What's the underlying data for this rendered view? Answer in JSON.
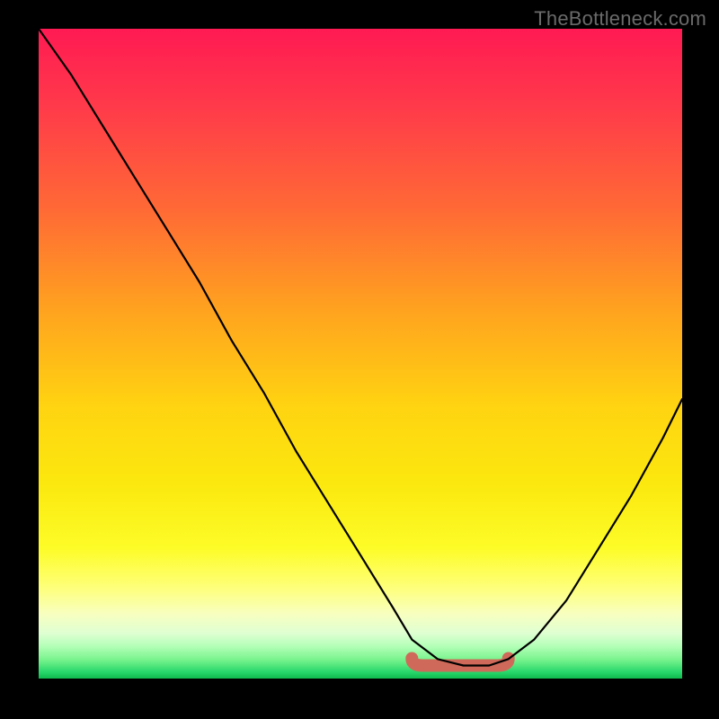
{
  "attribution": "TheBottleneck.com",
  "colors": {
    "page_bg": "#000000",
    "attribution_text": "#6a6a6a",
    "curve": "#000000",
    "valley_stroke": "#cf6a5a",
    "gradient_stops": [
      "#ff1a53",
      "#ff3a4a",
      "#ff6a35",
      "#ffa51e",
      "#ffd311",
      "#fbe80e",
      "#fdfc28",
      "#feff7a",
      "#f8ffbf",
      "#dfffd2",
      "#b4ffb8",
      "#7cf48f",
      "#27d86b",
      "#0fba4e"
    ]
  },
  "chart_data": {
    "type": "line",
    "title": "",
    "xlabel": "",
    "ylabel": "",
    "xlim": [
      0,
      100
    ],
    "ylim": [
      0,
      100
    ],
    "series": [
      {
        "name": "bottleneck-curve",
        "x": [
          0,
          5,
          10,
          15,
          20,
          25,
          30,
          35,
          40,
          45,
          50,
          55,
          58,
          62,
          66,
          70,
          73,
          77,
          82,
          87,
          92,
          97,
          100
        ],
        "y": [
          100,
          93,
          85,
          77,
          69,
          61,
          52,
          44,
          35,
          27,
          19,
          11,
          6,
          3,
          2,
          2,
          3,
          6,
          12,
          20,
          28,
          37,
          43
        ]
      }
    ],
    "valley_marker": {
      "x_start": 58,
      "x_end": 73,
      "y": 2
    }
  }
}
